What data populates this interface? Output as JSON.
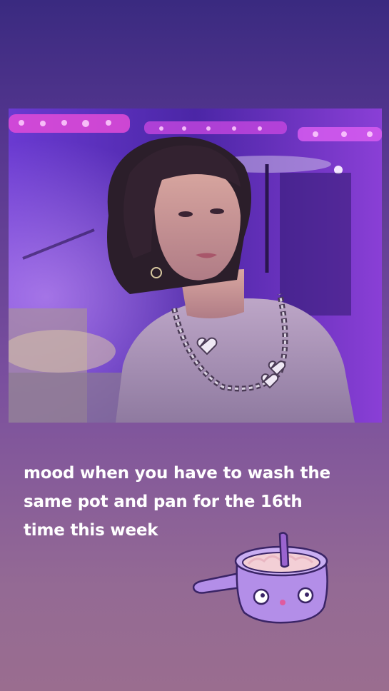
{
  "story": {
    "caption_lines": [
      "mood when you have to wash the",
      "same pot and pan for the 16th",
      "time this week"
    ],
    "sticker": "pot-with-face-sticker",
    "photo": "performer-on-stage-photo"
  },
  "colors": {
    "background_top": "#3a2a80",
    "background_bottom": "#9a6d8f",
    "caption_text": "#ffffff",
    "sticker_fill": "#b38ee8",
    "sticker_outline": "#3a2466"
  }
}
